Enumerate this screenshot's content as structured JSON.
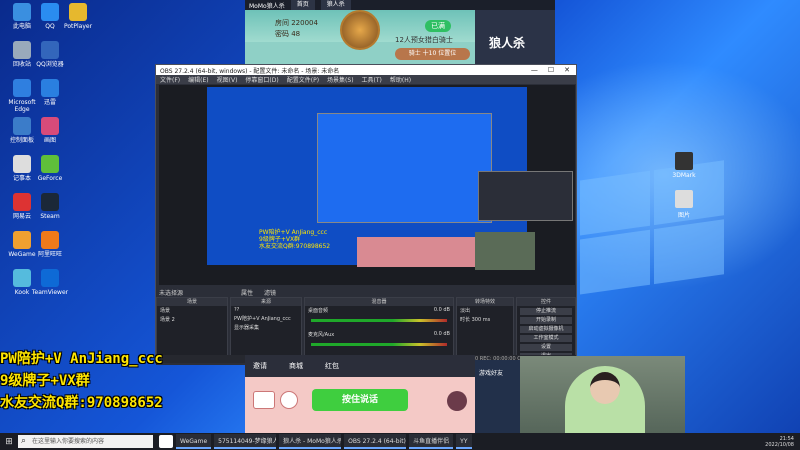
{
  "desktop_icons": [
    {
      "label": "此电脑",
      "color": "#3a8fe0"
    },
    {
      "label": "QQ",
      "color": "#2a8cf0"
    },
    {
      "label": "PotPlayer",
      "color": "#e6b82e"
    },
    {
      "label": "回收站",
      "color": "#9ab"
    },
    {
      "label": "QQ浏览器",
      "color": "#36b"
    },
    {
      "label": "Microsoft Edge",
      "color": "#2f7fe0"
    },
    {
      "label": "迅雷",
      "color": "#2a7fe0"
    },
    {
      "label": "控制面板",
      "color": "#3b7cc9"
    },
    {
      "label": "画图",
      "color": "#d84b7a"
    },
    {
      "label": "记事本",
      "color": "#ddd"
    },
    {
      "label": "GeForce",
      "color": "#5fbf3a"
    },
    {
      "label": "网易云",
      "color": "#d33"
    },
    {
      "label": "Steam",
      "color": "#1b2838"
    },
    {
      "label": "WeGame",
      "color": "#f0a030"
    },
    {
      "label": "阿里旺旺",
      "color": "#f07a1a"
    },
    {
      "label": "Kook",
      "color": "#5bd"
    },
    {
      "label": "TeamViewer",
      "color": "#0e6ad6"
    }
  ],
  "right_icons": [
    {
      "label": "3DMark",
      "color": "#333"
    },
    {
      "label": "图片",
      "color": "#ddd"
    }
  ],
  "momo": {
    "tab1": "MoMo狼人杀",
    "tab2": "首页",
    "tab3": "狼人杀",
    "room_label": "房间 220004",
    "pwd_label": "密码 48",
    "status": "已满",
    "players": "12人预女猎白骑士",
    "side_text": "骑士 十10 位置位",
    "brand": "狼人杀"
  },
  "obs": {
    "title": "OBS 27.2.4 (64-bit, windows) - 配置文件: 未命名 - 场景: 未命名",
    "menu": [
      "文件(F)",
      "编辑(E)",
      "视图(V)",
      "停靠窗口(D)",
      "配置文件(P)",
      "场景集(S)",
      "工具(T)",
      "帮助(H)"
    ],
    "nested_text": [
      "PW陪护+V AnJiang_ccc",
      "9级牌子+VX群",
      "水友交流Q群:970898652"
    ],
    "docks": {
      "scenes": {
        "title": "场景",
        "items": [
          "场景",
          "场景 2"
        ]
      },
      "sources": {
        "title": "来源",
        "items": [
          "??",
          "PW陪护+V AnJiang_ccc",
          "显示器采集"
        ]
      },
      "mixer": {
        "title": "混音器",
        "items": [
          "桌面音频",
          "麦克风/Aux"
        ],
        "db": [
          "0.0 dB",
          "0.0 dB"
        ]
      },
      "transitions": {
        "title": "转场特效",
        "fade": "淡出",
        "duration_label": "时长",
        "duration": "300 ms"
      },
      "controls": {
        "title": "控件",
        "buttons": [
          "停止推流",
          "开始录制",
          "启动虚拟摄像机",
          "工作室模式",
          "设置",
          "退出"
        ]
      },
      "bottom_label": "未选择源",
      "tab_attr": "属性",
      "tab_filters": "滤镜"
    },
    "status": "LIVE: 00:00:00   REC: 00:00:00   CPU: 5.1%, 60.00 fps"
  },
  "overlay": [
    "PW陪护+V AnJiang_ccc",
    "9级牌子+VX群",
    "水友交流Q群:970898652"
  ],
  "bottom_game": {
    "nav": [
      "邀请",
      "商城",
      "红包"
    ],
    "talk_button": "按住说话",
    "side": "游戏好友"
  },
  "taskbar": {
    "search_placeholder": "在这里输入你要搜索的内容",
    "tasks": [
      "WeGame",
      "575114049-梦缘狼人杀",
      "狼人杀 - MoMo狼人杀",
      "OBS 27.2.4 (64-bit)",
      "斗鱼直播伴侣",
      "YY"
    ],
    "time": "21:54",
    "date": "2022/10/08"
  }
}
